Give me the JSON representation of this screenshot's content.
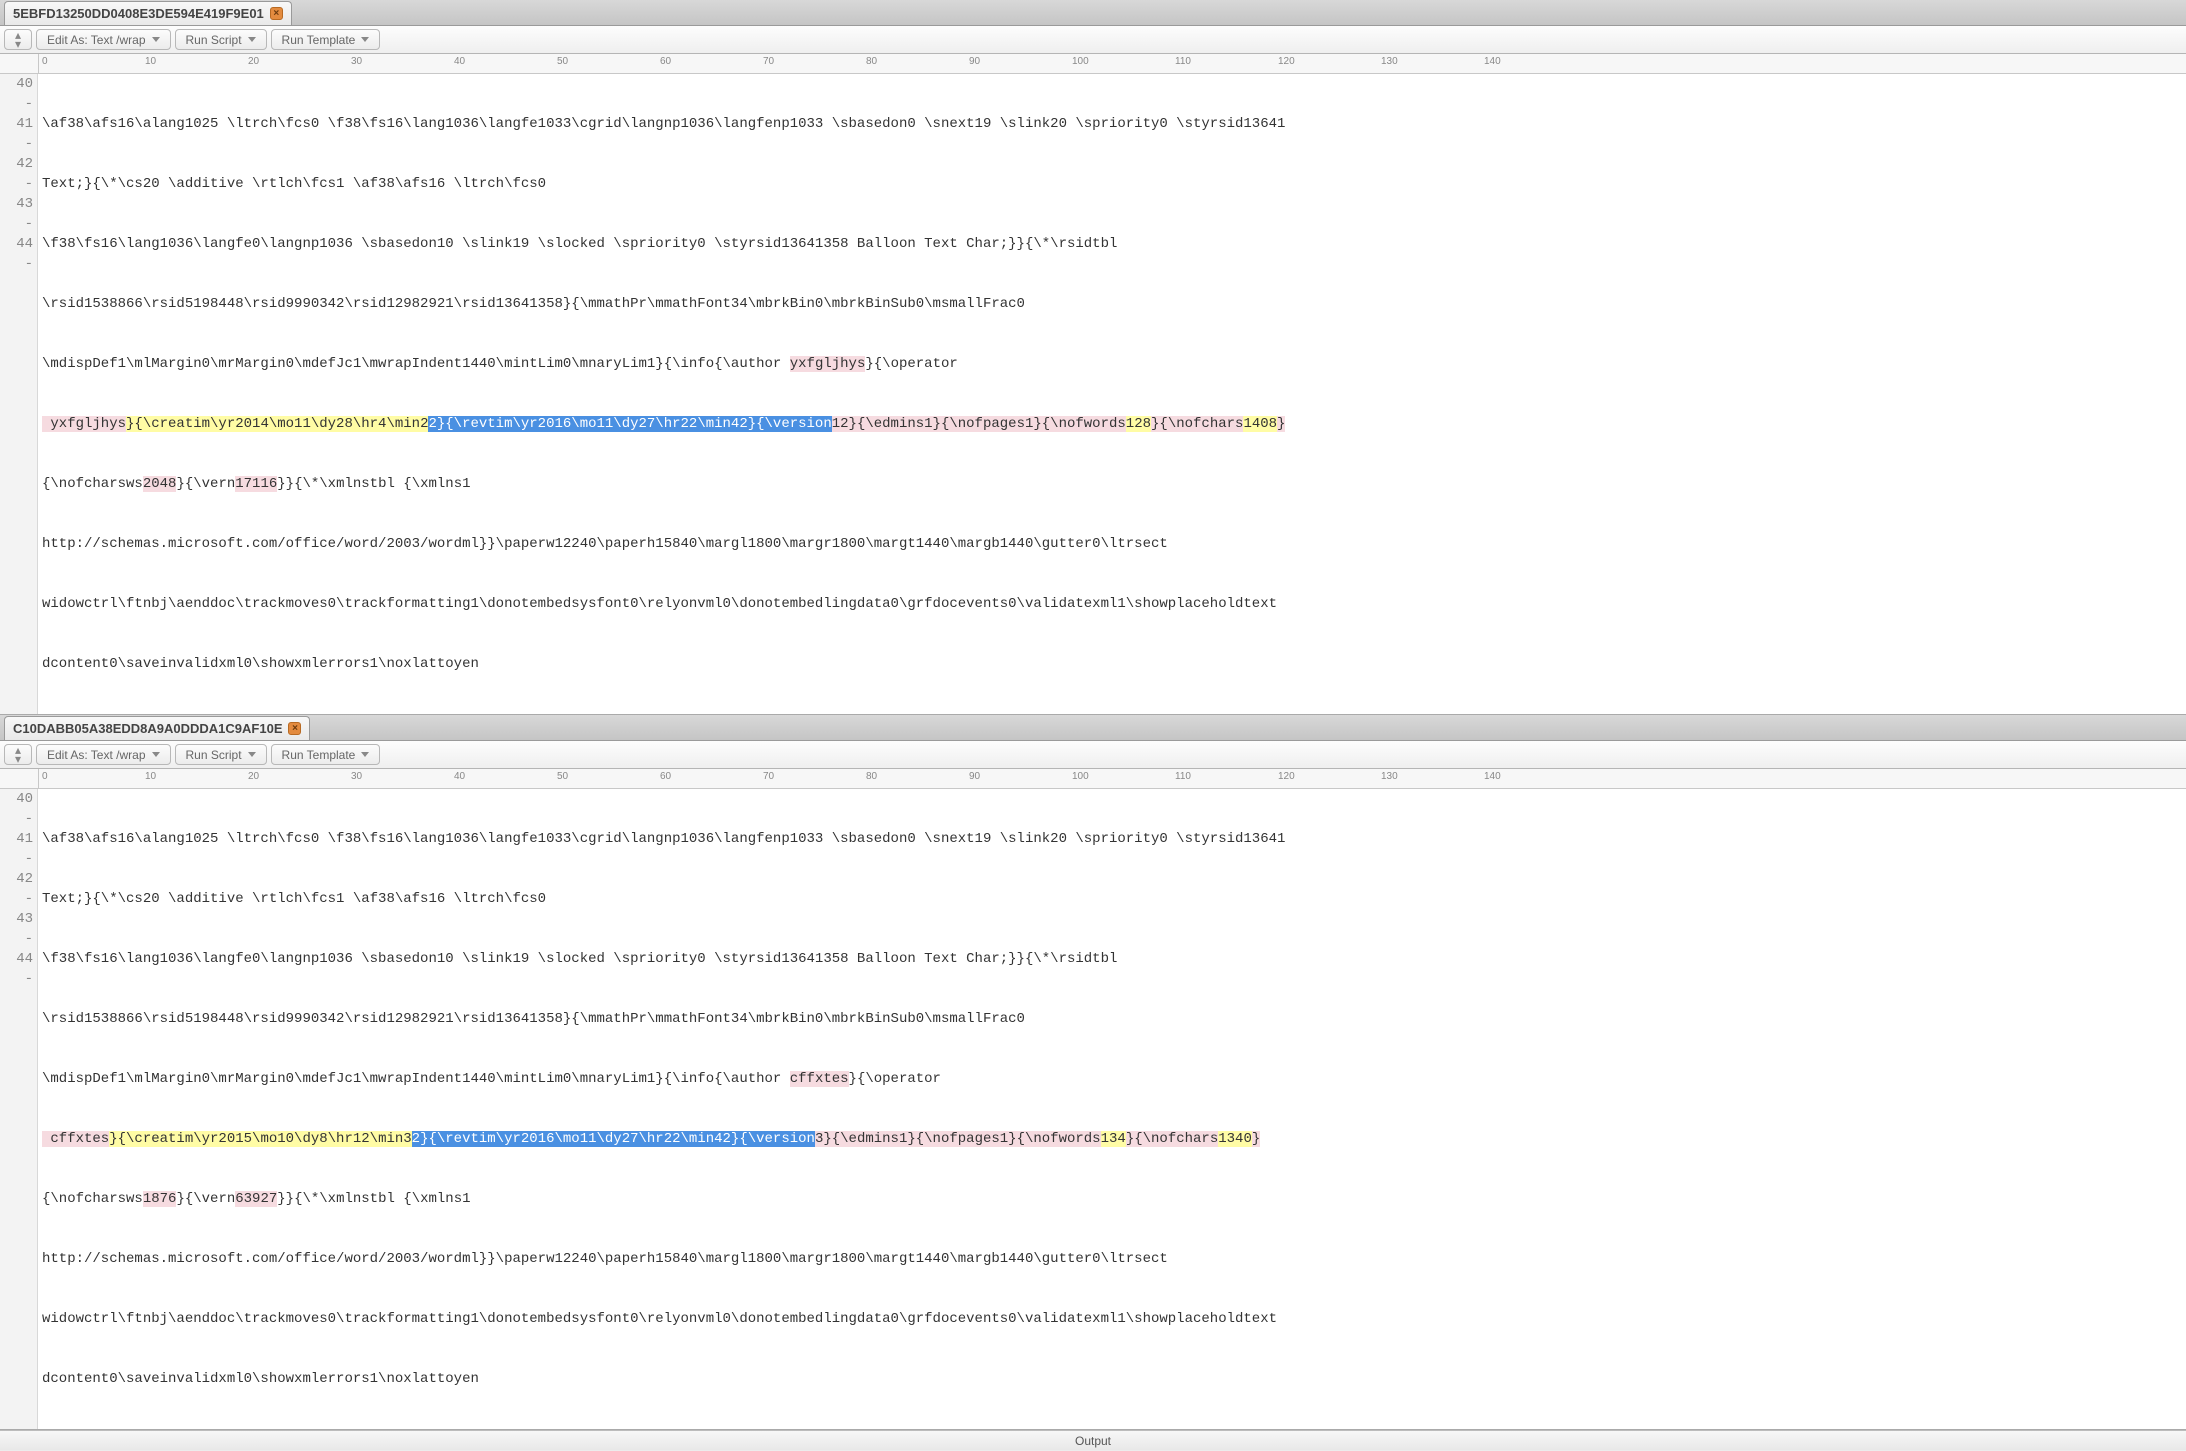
{
  "toolbar": {
    "editAs": "Edit As: Text /wrap",
    "runScript": "Run Script",
    "runTemplate": "Run Template"
  },
  "rulerTicks": [
    0,
    10,
    20,
    30,
    40,
    50,
    60,
    70,
    80,
    90,
    100,
    110,
    120,
    130,
    140
  ],
  "topPane": {
    "tabTitle": "5EBFD13250DD0408E3DE594E419F9E01",
    "lineNumbers": [
      "40",
      "-",
      "41",
      "-",
      "42",
      "-",
      "43",
      "-",
      "44",
      "-"
    ],
    "lines": {
      "l40": "\\af38\\afs16\\alang1025 \\ltrch\\fcs0 \\f38\\fs16\\lang1036\\langfe1033\\cgrid\\langnp1036\\langfenp1033 \\sbasedon0 \\snext19 \\slink20 \\spriority0 \\styrsid13641",
      "l40b": "Text;}{\\*\\cs20 \\additive \\rtlch\\fcs1 \\af38\\afs16 \\ltrch\\fcs0",
      "l41": "\\f38\\fs16\\lang1036\\langfe0\\langnp1036 \\sbasedon10 \\slink19 \\slocked \\spriority0 \\styrsid13641358 Balloon Text Char;}}{\\*\\rsidtbl",
      "l41b": "\\rsid1538866\\rsid5198448\\rsid9990342\\rsid12982921\\rsid13641358}{\\mmathPr\\mmathFont34\\mbrkBin0\\mbrkBinSub0\\msmallFrac0",
      "l42a": "\\mdispDef1\\mlMargin0\\mrMargin0\\mdefJc1\\mwrapIndent1440\\mintLim0\\mnaryLim1}{\\info{\\author ",
      "l42_auth": "yxfgljhys",
      "l42b": "}{\\operator",
      "l42c_op": " yxfgljhys",
      "l42c_creatim": "}{\\creatim\\yr2014\\mo11\\dy28\\hr4\\min2",
      "l42c_sel": "2}{\\revtim\\yr2016\\mo11\\dy27\\hr22\\min42}{\\version",
      "l42c_after1": "12}{\\edmins1}{\\nofpages1}{\\nofwords",
      "l42c_words": "128",
      "l42c_mid": "}{\\nofchars",
      "l42c_chars": "1408",
      "l42c_end": "}",
      "l43a": "{\\nofcharsws",
      "l43a_val": "2048",
      "l43a_mid": "}{\\vern",
      "l43a_vern": "17116",
      "l43a_end": "}}{\\*\\xmlnstbl {\\xmlns1",
      "l43b": "http://schemas.microsoft.com/office/word/2003/wordml}}\\paperw12240\\paperh15840\\margl1800\\margr1800\\margt1440\\margb1440\\gutter0\\ltrsect",
      "l44a": "widowctrl\\ftnbj\\aenddoc\\trackmoves0\\trackformatting1\\donotembedsysfont0\\relyonvml0\\donotembedlingdata0\\grfdocevents0\\validatexml1\\showplaceholdtext",
      "l44b": "dcontent0\\saveinvalidxml0\\showxmlerrors1\\noxlattoyen"
    }
  },
  "bottomPane": {
    "tabTitle": "C10DABB05A38EDD8A9A0DDDA1C9AF10E",
    "lineNumbers": [
      "40",
      "-",
      "41",
      "-",
      "42",
      "-",
      "43",
      "-",
      "44",
      "-"
    ],
    "lines": {
      "l40": "\\af38\\afs16\\alang1025 \\ltrch\\fcs0 \\f38\\fs16\\lang1036\\langfe1033\\cgrid\\langnp1036\\langfenp1033 \\sbasedon0 \\snext19 \\slink20 \\spriority0 \\styrsid13641",
      "l40b": "Text;}{\\*\\cs20 \\additive \\rtlch\\fcs1 \\af38\\afs16 \\ltrch\\fcs0",
      "l41": "\\f38\\fs16\\lang1036\\langfe0\\langnp1036 \\sbasedon10 \\slink19 \\slocked \\spriority0 \\styrsid13641358 Balloon Text Char;}}{\\*\\rsidtbl",
      "l41b": "\\rsid1538866\\rsid5198448\\rsid9990342\\rsid12982921\\rsid13641358}{\\mmathPr\\mmathFont34\\mbrkBin0\\mbrkBinSub0\\msmallFrac0",
      "l42a": "\\mdispDef1\\mlMargin0\\mrMargin0\\mdefJc1\\mwrapIndent1440\\mintLim0\\mnaryLim1}{\\info{\\author ",
      "l42_auth": "cffxtes",
      "l42b": "}{\\operator",
      "l42c_op": " cffxtes",
      "l42c_creatim": "}{\\creatim\\yr2015\\mo10\\dy8\\hr12\\min3",
      "l42c_sel": "2}{\\revtim\\yr2016\\mo11\\dy27\\hr22\\min42}{\\version",
      "l42c_after1": "3}{\\edmins1}{\\nofpages1}{\\nofwords",
      "l42c_words": "134",
      "l42c_mid": "}{\\nofchars",
      "l42c_chars": "1340",
      "l42c_end": "}",
      "l43a": "{\\nofcharsws",
      "l43a_val": "1876",
      "l43a_mid": "}{\\vern",
      "l43a_vern": "63927",
      "l43a_end": "}}{\\*\\xmlnstbl {\\xmlns1",
      "l43b": "http://schemas.microsoft.com/office/word/2003/wordml}}\\paperw12240\\paperh15840\\margl1800\\margr1800\\margt1440\\margb1440\\gutter0\\ltrsect",
      "l44a": "widowctrl\\ftnbj\\aenddoc\\trackmoves0\\trackformatting1\\donotembedsysfont0\\relyonvml0\\donotembedlingdata0\\grfdocevents0\\validatexml1\\showplaceholdtext",
      "l44b": "dcontent0\\saveinvalidxml0\\showxmlerrors1\\noxlattoyen"
    }
  },
  "bottomBar": {
    "label": "Output"
  }
}
